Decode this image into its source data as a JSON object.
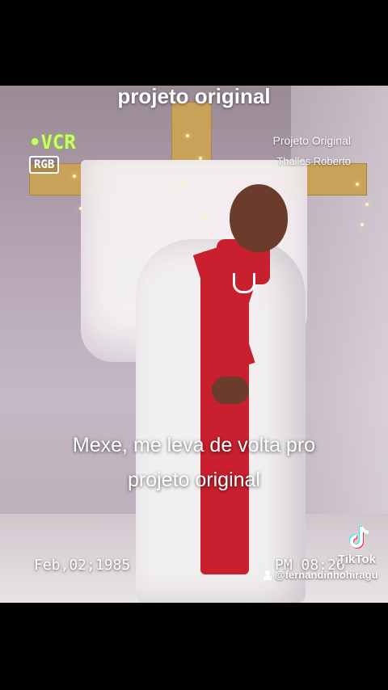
{
  "overlay": {
    "top_caption": "projeto original",
    "vcr_label": "•VCR",
    "rgb_label": "RGB",
    "credit_line1": "Projeto Original",
    "credit_line2": "Thalles Roberto",
    "lyric_line1": "Mexe, me leva de volta pro",
    "lyric_line2": "projeto original",
    "date": "Feb,02;1985",
    "time": "PM 08:26"
  },
  "tiktok": {
    "label": "TikTok",
    "username": "@fernandinhohiragu",
    "icon": "tiktok-logo-icon",
    "user_icon": "person-icon"
  },
  "colors": {
    "vcr_green": "#c9ff5a",
    "robe_red": "#c8202e",
    "cross_wood": "#c9a25a"
  }
}
